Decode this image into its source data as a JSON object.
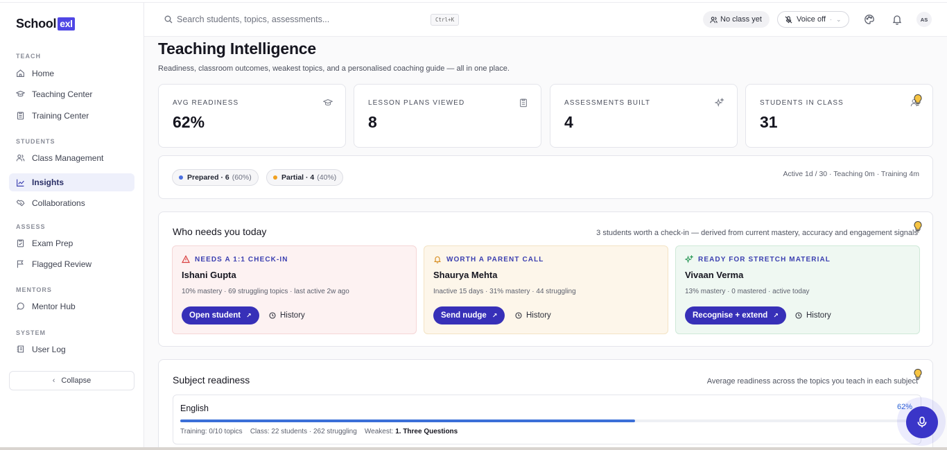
{
  "brand": {
    "name": "School",
    "badge": "exl",
    "accent": "#4f46e5"
  },
  "sidebar": {
    "sections": [
      {
        "label": "TEACH",
        "items": [
          {
            "label": "Home",
            "icon": "home-icon"
          },
          {
            "label": "Teaching Center",
            "icon": "graduation-cap-icon"
          },
          {
            "label": "Training Center",
            "icon": "clipboard-icon"
          }
        ]
      },
      {
        "label": "STUDENTS",
        "items": [
          {
            "label": "Class Management",
            "icon": "users-icon"
          },
          {
            "label": "Insights",
            "icon": "line-chart-icon",
            "active": true
          },
          {
            "label": "Collaborations",
            "icon": "handshake-icon"
          }
        ]
      },
      {
        "label": "ASSESS",
        "items": [
          {
            "label": "Exam Prep",
            "icon": "clipboard-check-icon"
          },
          {
            "label": "Flagged Review",
            "icon": "flag-icon"
          }
        ]
      },
      {
        "label": "MENTORS",
        "items": [
          {
            "label": "Mentor Hub",
            "icon": "chat-bubble-icon"
          }
        ]
      },
      {
        "label": "SYSTEM",
        "items": [
          {
            "label": "User Log",
            "icon": "log-icon"
          }
        ]
      }
    ],
    "collapse_label": "Collapse"
  },
  "header": {
    "search_placeholder": "Search students, topics, assessments...",
    "shortcut": "Ctrl+K",
    "class_chip": "No class yet",
    "voice_chip": "Voice off",
    "voice_extra": "·",
    "avatar_initials": "AS"
  },
  "page": {
    "title": "Teaching Intelligence",
    "subtitle": "Readiness, classroom outcomes, weakest topics, and a personalised coaching guide — all in one place."
  },
  "stats": [
    {
      "label": "AVG READINESS",
      "value": "62%",
      "icon": "graduation-cap-icon"
    },
    {
      "label": "LESSON PLANS VIEWED",
      "value": "8",
      "icon": "clipboard-icon"
    },
    {
      "label": "ASSESSMENTS BUILT",
      "value": "4",
      "icon": "sparkles-icon"
    },
    {
      "label": "STUDENTS IN CLASS",
      "value": "31",
      "icon": "users-icon"
    }
  ],
  "readiness": {
    "prepared": {
      "label": "Prepared · 6",
      "pct": "(60%)",
      "color": "#4a6fe0"
    },
    "partial": {
      "label": "Partial · 4",
      "pct": "(40%)",
      "color": "#f0a020"
    },
    "activity": "Active 1d / 30 · Teaching 0m · Training 4m"
  },
  "needs": {
    "title": "Who needs you today",
    "note": "3 students worth a check-in — derived from current mastery, accuracy and engagement signals",
    "cards": [
      {
        "tag": "NEEDS A 1:1 CHECK-IN",
        "name": "Ishani Gupta",
        "meta": "10% mastery · 69 struggling topics · last active 2w ago",
        "button": "Open student",
        "history": "History",
        "icon": "alert-triangle-icon"
      },
      {
        "tag": "WORTH A PARENT CALL",
        "name": "Shaurya Mehta",
        "meta": "Inactive 15 days · 31% mastery · 44 struggling",
        "button": "Send nudge",
        "history": "History",
        "icon": "bell-icon"
      },
      {
        "tag": "READY FOR STRETCH MATERIAL",
        "name": "Vivaan Verma",
        "meta": "13% mastery · 0 mastered · active today",
        "button": "Recognise + extend",
        "history": "History",
        "icon": "sparkles-icon"
      }
    ]
  },
  "subjects": {
    "title": "Subject readiness",
    "note": "Average readiness across the topics you teach in each subject",
    "items": [
      {
        "name": "English",
        "pct": "62%",
        "value": 0.62,
        "training": "Training: 0/10 topics",
        "class": "Class: 22 students · 262 struggling",
        "weakest_label": "Weakest:",
        "weakest": "1. Three Questions"
      }
    ]
  }
}
